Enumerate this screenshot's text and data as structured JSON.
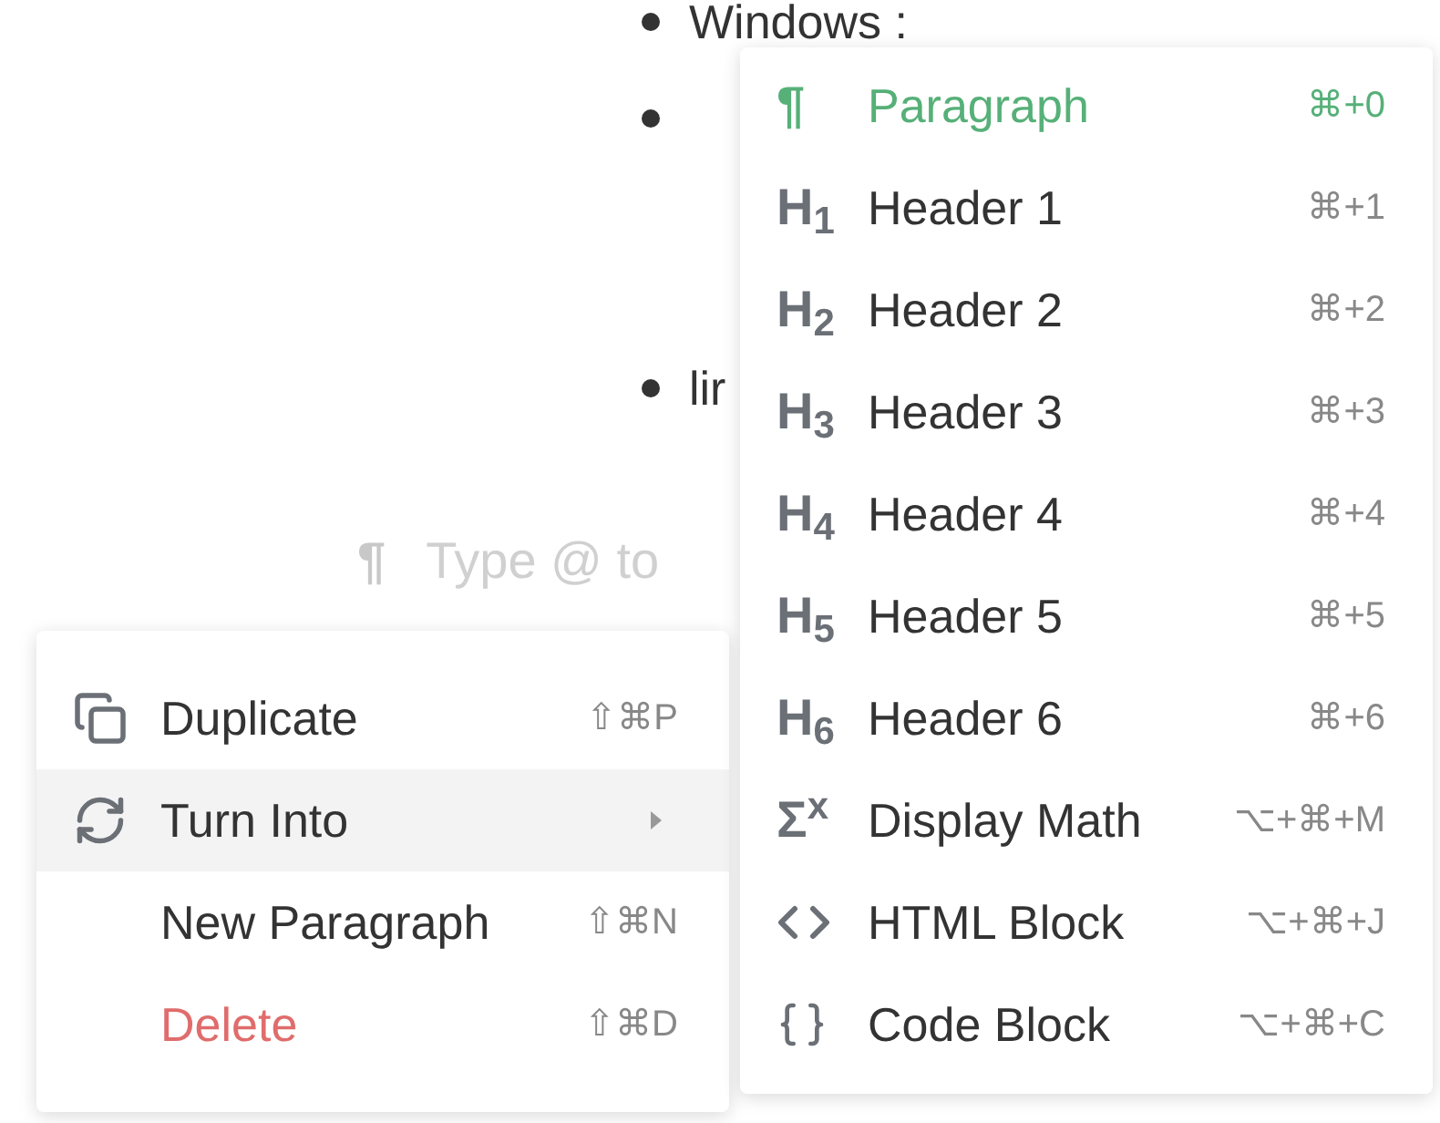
{
  "document": {
    "bullets": [
      {
        "kind": "text",
        "text": "Windows :"
      },
      {
        "kind": "covered"
      },
      {
        "kind": "text",
        "text": "lir"
      }
    ],
    "empty_line": {
      "icon": "¶",
      "placeholder": "Type @ to"
    }
  },
  "context_menu": {
    "items": [
      {
        "kind": "duplicate",
        "label": "Duplicate",
        "shortcut": "⇧⌘P",
        "selected": false,
        "danger": false,
        "submenu": false
      },
      {
        "kind": "turn",
        "label": "Turn Into",
        "selected": true,
        "danger": false,
        "submenu": true
      },
      {
        "kind": "none",
        "label": "New Paragraph",
        "shortcut": "⇧⌘N",
        "selected": false,
        "danger": false,
        "submenu": false
      },
      {
        "kind": "none",
        "label": "Delete",
        "shortcut": "⇧⌘D",
        "selected": false,
        "danger": true,
        "submenu": false
      }
    ]
  },
  "submenu": {
    "items": [
      {
        "kind": "glyph",
        "glyph": "¶",
        "label": "Paragraph",
        "shortcut": "⌘+0",
        "selected": true
      },
      {
        "kind": "glyph",
        "glyph": "H$_{1}$",
        "label": "Header 1",
        "shortcut": "⌘+1",
        "selected": false
      },
      {
        "kind": "glyph",
        "glyph": "H$_{2}$",
        "label": "Header 2",
        "shortcut": "⌘+2",
        "selected": false
      },
      {
        "kind": "glyph",
        "glyph": "H$_{3}$",
        "label": "Header 3",
        "shortcut": "⌘+3",
        "selected": false
      },
      {
        "kind": "glyph",
        "glyph": "H$_{4}$",
        "label": "Header 4",
        "shortcut": "⌘+4",
        "selected": false
      },
      {
        "kind": "glyph",
        "glyph": "H$_{5}$",
        "label": "Header 5",
        "shortcut": "⌘+5",
        "selected": false
      },
      {
        "kind": "glyph",
        "glyph": "H$_{6}$",
        "label": "Header 6",
        "shortcut": "⌘+6",
        "selected": false
      },
      {
        "kind": "glyph",
        "glyph": "Σ$^{x}$",
        "label": "Display Math",
        "shortcut": "⌥+⌘+M",
        "selected": false
      },
      {
        "kind": "html",
        "label": "HTML Block",
        "shortcut": "⌥+⌘+J",
        "selected": false
      },
      {
        "kind": "code",
        "label": "Code Block",
        "shortcut": "⌥+⌘+C",
        "selected": false
      }
    ]
  }
}
